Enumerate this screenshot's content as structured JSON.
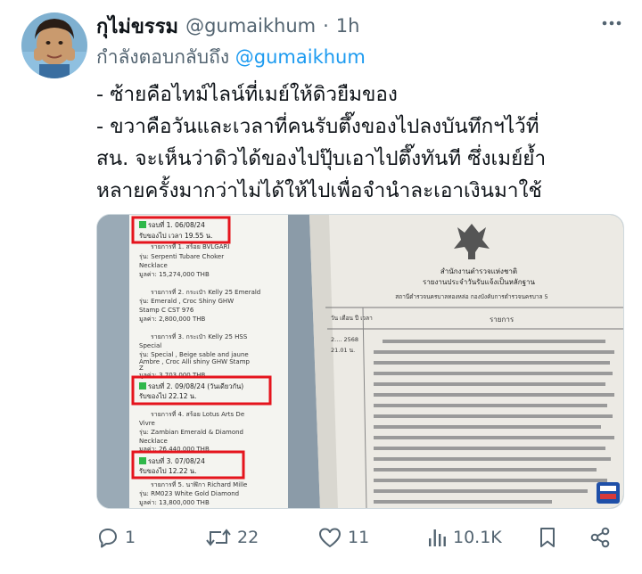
{
  "tweet": {
    "display_name": "กุไม่ขรรม",
    "handle": "@gumaikhum",
    "separator": "·",
    "time": "1h",
    "reply_prefix": "กำลังตอบกลับถึง ",
    "reply_to": "@gumaikhum",
    "lines": [
      "- ซ้ายคือไทม์ไลน์ที่เมย์ให้ดิวยืมของ",
      "- ขวาคือวันและเวลาที่คนรับตึ๊งของไปลงบันทึกฯไว้ที่",
      "สน. จะเห็นว่าดิวได้ของไปปุ๊บเอาไปตึ๊งทันที ซึ่งเมย์ย้ำ",
      "หลายครั้งมากว่าไม่ได้ให้ไปเพื่อจำนำละเอาเงินมาใช้"
    ]
  },
  "image_left": {
    "round1": "รอบที่ 1. 06/08/24",
    "round1_time": "รับของไป เวลา 19.55 น.",
    "item1": "รายการที่ 1. สร้อย BVLGARI",
    "item1_model": "รุ่น: Serpenti Tubare Choker",
    "item1_model2": "Necklace",
    "item1_value": "มูลค่า: 15,274,000 THB",
    "item2": "รายการที่ 2. กระเป๋า Kelly 25 Emerald",
    "item2_model": "รุ่น: Emerald , Croc Shiny GHW",
    "item2_model2": "Stamp C CST 976",
    "item2_value": "มูลค่า: 2,800,000 THB",
    "item3": "รายการที่ 3. กระเป๋า Kelly 25 HSS",
    "item3_model": "Special",
    "item3_model2": "รุ่น: Special , Beige sable and jaune",
    "item3_model3": "Ambre , Croc Alli shiny GHW Stamp",
    "item3_model4": "Z",
    "item3_value": "มูลค่า: 3,703,000 THB",
    "round2": "รอบที่ 2. 09/08/24 (วันเดียวกัน)",
    "round2_time": "รับของไป 22.12 น.",
    "item4": "รายการที่ 4. สร้อย Lotus Arts De",
    "item4_model": "Vivre",
    "item4_model2": "รุ่น: Zambian Emerald & Diamond",
    "item4_model3": "Necklace",
    "item4_value": "มูลค่า: 26,440,000 THB",
    "round3": "รอบที่ 3. 07/08/24",
    "round3_time": "รับของไป 12.22 น.",
    "item5": "รายการที่ 5. นาฬิกา Richard Mille",
    "item5_model": "รุ่น: RM023 White Gold Diamond",
    "item5_value": "มูลค่า: 13,800,000 THB"
  },
  "image_right": {
    "agency": "สำนักงานตำรวจแห่งชาติ",
    "report": "รายงานประจำวันรับแจ้งเป็นหลักฐาน",
    "station": "สถานีตำรวจนครบาลทองหล่อ  กองบังคับการตำรวจนครบาล 5",
    "col_date": "วัน เดือน ปี เวลา",
    "col_item": "รายการ",
    "date1": "2.... 2568",
    "time1": "21.01 น.",
    "watermark": "ไทยพีบีเอส"
  },
  "actions": {
    "replies": "1",
    "reposts": "22",
    "likes": "11",
    "views": "10.1K"
  },
  "colors": {
    "text": "#0f1419",
    "muted": "#536471",
    "accent": "#1d9bf0",
    "highlight_box": "#e5141d",
    "check": "#2fb84a"
  }
}
